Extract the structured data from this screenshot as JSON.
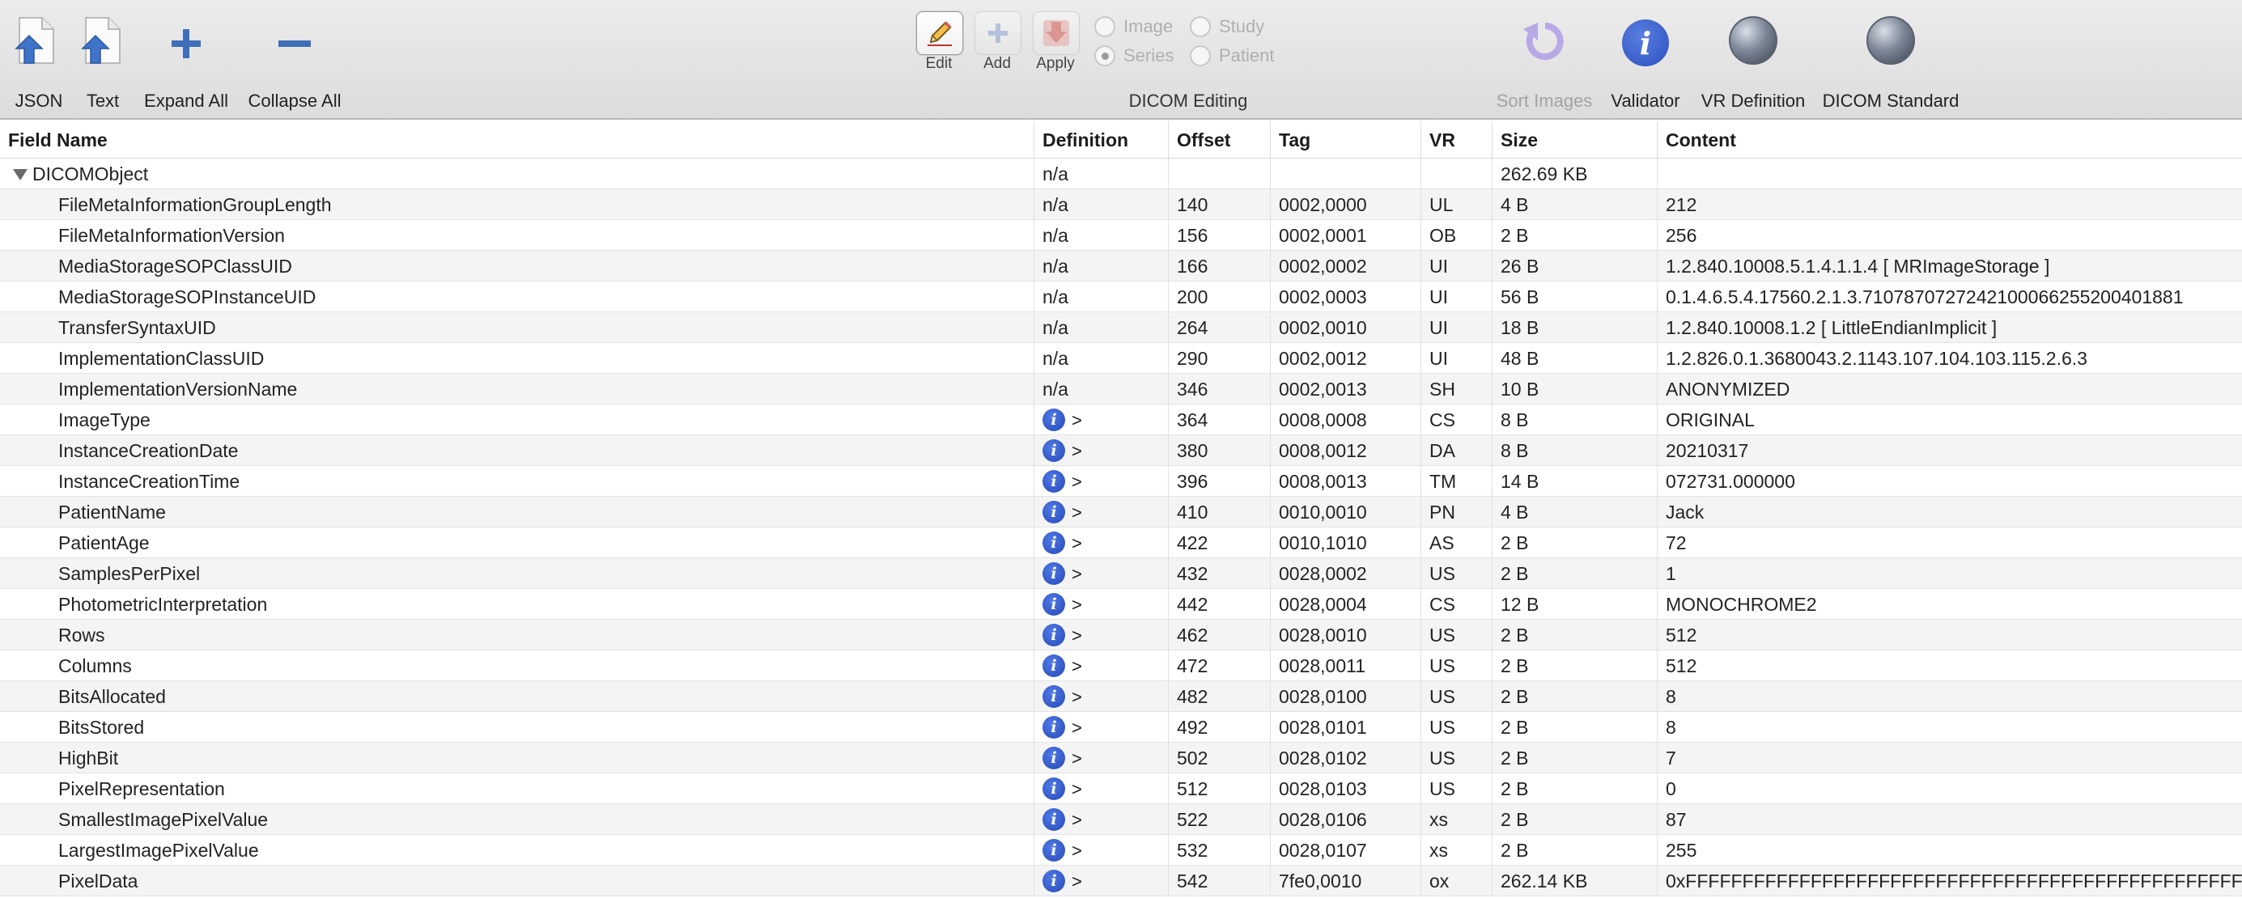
{
  "toolbar": {
    "left_buttons": [
      {
        "label": "JSON",
        "icon": "json-export-icon"
      },
      {
        "label": "Text",
        "icon": "text-export-icon"
      },
      {
        "label": "Expand All",
        "icon": "plus-icon"
      },
      {
        "label": "Collapse All",
        "icon": "minus-icon"
      }
    ],
    "editing": {
      "edit_label": "Edit",
      "add_label": "Add",
      "apply_label": "Apply",
      "radios": [
        {
          "label": "Image",
          "selected": false
        },
        {
          "label": "Study",
          "selected": false
        },
        {
          "label": "Series",
          "selected": true
        },
        {
          "label": "Patient",
          "selected": false
        }
      ],
      "group_label": "DICOM Editing"
    },
    "right_buttons": [
      {
        "label": "Sort Images",
        "icon": "sort-undo-icon",
        "enabled": false
      },
      {
        "label": "Validator",
        "icon": "info-icon",
        "enabled": true
      },
      {
        "label": "VR Definition",
        "icon": "globe-icon",
        "enabled": true
      },
      {
        "label": "DICOM Standard",
        "icon": "globe-icon",
        "enabled": true
      }
    ]
  },
  "table": {
    "columns": [
      "Field Name",
      "Definition",
      "Offset",
      "Tag",
      "VR",
      "Size",
      "Content"
    ],
    "root": {
      "field": "DICOMObject",
      "definition": "n/a",
      "offset": "",
      "tag": "",
      "vr": "",
      "size": "262.69 KB",
      "content": ""
    },
    "rows": [
      {
        "field": "FileMetaInformationGroupLength",
        "definition": "n/a",
        "offset": "140",
        "tag": "0002,0000",
        "vr": "UL",
        "size": "4 B",
        "content": "212"
      },
      {
        "field": "FileMetaInformationVersion",
        "definition": "n/a",
        "offset": "156",
        "tag": "0002,0001",
        "vr": "OB",
        "size": "2 B",
        "content": "256"
      },
      {
        "field": "MediaStorageSOPClassUID",
        "definition": "n/a",
        "offset": "166",
        "tag": "0002,0002",
        "vr": "UI",
        "size": "26 B",
        "content": "1.2.840.10008.5.1.4.1.1.4 [ MRImageStorage ]"
      },
      {
        "field": "MediaStorageSOPInstanceUID",
        "definition": "n/a",
        "offset": "200",
        "tag": "0002,0003",
        "vr": "UI",
        "size": "56 B",
        "content": "0.1.4.6.5.4.17560.2.1.3.7107870727242100066255200401881"
      },
      {
        "field": "TransferSyntaxUID",
        "definition": "n/a",
        "offset": "264",
        "tag": "0002,0010",
        "vr": "UI",
        "size": "18 B",
        "content": "1.2.840.10008.1.2 [ LittleEndianImplicit ]"
      },
      {
        "field": "ImplementationClassUID",
        "definition": "n/a",
        "offset": "290",
        "tag": "0002,0012",
        "vr": "UI",
        "size": "48 B",
        "content": "1.2.826.0.1.3680043.2.1143.107.104.103.115.2.6.3"
      },
      {
        "field": "ImplementationVersionName",
        "definition": "n/a",
        "offset": "346",
        "tag": "0002,0013",
        "vr": "SH",
        "size": "10 B",
        "content": "ANONYMIZED"
      },
      {
        "field": "ImageType",
        "definition": "info",
        "offset": "364",
        "tag": "0008,0008",
        "vr": "CS",
        "size": "8 B",
        "content": "ORIGINAL"
      },
      {
        "field": "InstanceCreationDate",
        "definition": "info",
        "offset": "380",
        "tag": "0008,0012",
        "vr": "DA",
        "size": "8 B",
        "content": "20210317"
      },
      {
        "field": "InstanceCreationTime",
        "definition": "info",
        "offset": "396",
        "tag": "0008,0013",
        "vr": "TM",
        "size": "14 B",
        "content": "072731.000000"
      },
      {
        "field": "PatientName",
        "definition": "info",
        "offset": "410",
        "tag": "0010,0010",
        "vr": "PN",
        "size": "4 B",
        "content": "Jack"
      },
      {
        "field": "PatientAge",
        "definition": "info",
        "offset": "422",
        "tag": "0010,1010",
        "vr": "AS",
        "size": "2 B",
        "content": "72"
      },
      {
        "field": "SamplesPerPixel",
        "definition": "info",
        "offset": "432",
        "tag": "0028,0002",
        "vr": "US",
        "size": "2 B",
        "content": "1"
      },
      {
        "field": "PhotometricInterpretation",
        "definition": "info",
        "offset": "442",
        "tag": "0028,0004",
        "vr": "CS",
        "size": "12 B",
        "content": "MONOCHROME2"
      },
      {
        "field": "Rows",
        "definition": "info",
        "offset": "462",
        "tag": "0028,0010",
        "vr": "US",
        "size": "2 B",
        "content": "512"
      },
      {
        "field": "Columns",
        "definition": "info",
        "offset": "472",
        "tag": "0028,0011",
        "vr": "US",
        "size": "2 B",
        "content": "512"
      },
      {
        "field": "BitsAllocated",
        "definition": "info",
        "offset": "482",
        "tag": "0028,0100",
        "vr": "US",
        "size": "2 B",
        "content": "8"
      },
      {
        "field": "BitsStored",
        "definition": "info",
        "offset": "492",
        "tag": "0028,0101",
        "vr": "US",
        "size": "2 B",
        "content": "8"
      },
      {
        "field": "HighBit",
        "definition": "info",
        "offset": "502",
        "tag": "0028,0102",
        "vr": "US",
        "size": "2 B",
        "content": "7"
      },
      {
        "field": "PixelRepresentation",
        "definition": "info",
        "offset": "512",
        "tag": "0028,0103",
        "vr": "US",
        "size": "2 B",
        "content": "0"
      },
      {
        "field": "SmallestImagePixelValue",
        "definition": "info",
        "offset": "522",
        "tag": "0028,0106",
        "vr": "xs",
        "size": "2 B",
        "content": "87"
      },
      {
        "field": "LargestImagePixelValue",
        "definition": "info",
        "offset": "532",
        "tag": "0028,0107",
        "vr": "xs",
        "size": "2 B",
        "content": "255"
      },
      {
        "field": "PixelData",
        "definition": "info",
        "offset": "542",
        "tag": "7fe0,0010",
        "vr": "ox",
        "size": "262.14 KB",
        "content": "0xFFFFFFFFFFFFFFFFFFFFFFFFFFFFFFFFFFFFFFFFFFFFFFFFFFFFFFFFFF"
      }
    ]
  },
  "colors": {
    "accent_blue": "#2a4fbf",
    "toolbar_bg": "#e4e4e4",
    "row_alt": "#f4f4f4"
  }
}
